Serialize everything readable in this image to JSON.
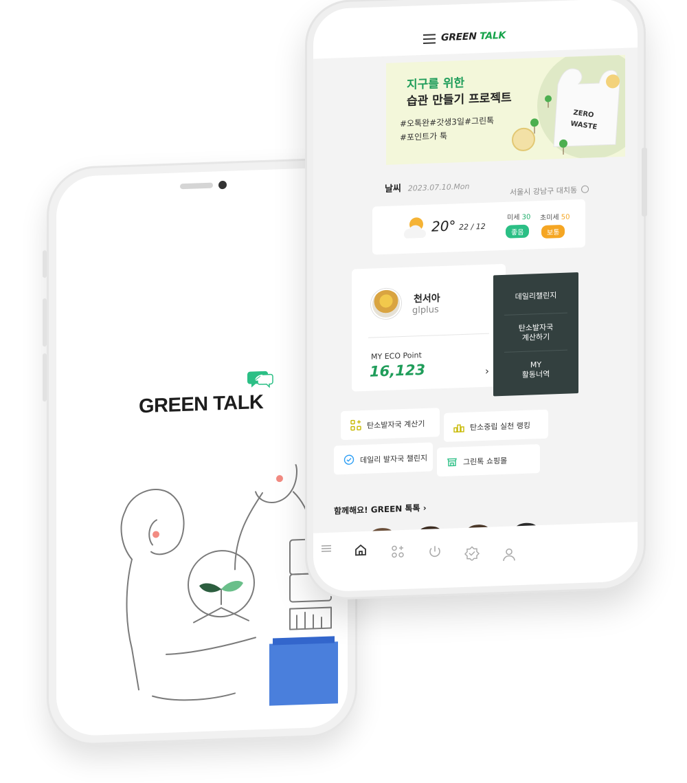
{
  "splash": {
    "logo_text": "GREEN TALK"
  },
  "app": {
    "title_green": "GREEN",
    "title_rest": "TALK",
    "banner": {
      "line1": "지구를 위한",
      "line2": "습관 만들기 프로젝트",
      "tags_line1": "#오톡완#갓생3일#그린톡",
      "tags_line2": "#포인트가 툭",
      "bag_text": "ZERO WASTE"
    },
    "weather": {
      "title": "날씨",
      "date": "2023.07.10.Mon",
      "location": "서울시 강남구 대치동",
      "temp": "20°",
      "range": "22 / 12",
      "dust_label": "미세",
      "dust_value": "30",
      "dust_status": "좋음",
      "fine_dust_label": "초미세",
      "fine_dust_value": "50",
      "fine_dust_status": "보통",
      "colors": {
        "good": "#2bbf85",
        "normal": "#f5a623"
      }
    },
    "profile": {
      "name": "천서아",
      "id": "glplus",
      "eco_label": "MY ECO Point",
      "eco_value": "16,123"
    },
    "side_menu": [
      {
        "label": "데일리챌린지"
      },
      {
        "label": "탄소발자국\n계산하기"
      },
      {
        "label": "MY\n활동너역"
      }
    ],
    "quick_menu": [
      {
        "label": "탄소발자국 계산기",
        "icon": "calculator-icon"
      },
      {
        "label": "탄소중립 실천 랭킹",
        "icon": "ranking-icon"
      },
      {
        "label": "데일리 발자국 챌린지",
        "icon": "check-circle-icon"
      },
      {
        "label": "그린톡 쇼핑몰",
        "icon": "shop-icon"
      }
    ],
    "together": "함께해요! GREEN 톡톡 ",
    "tabs": [
      "menu-icon",
      "home-icon",
      "apps-icon",
      "power-icon",
      "badge-icon",
      "user-icon"
    ],
    "accent": "#1f9d5a",
    "panel_color": "#33403f"
  }
}
